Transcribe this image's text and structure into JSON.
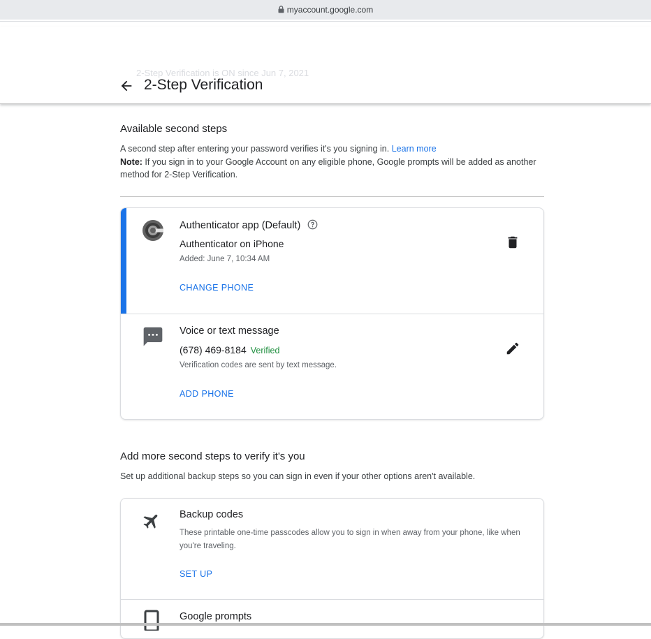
{
  "browser": {
    "url": "myaccount.google.com"
  },
  "header": {
    "title": "2-Step Verification",
    "ghost_text": "2-Step Verification is ON since Jun 7, 2021"
  },
  "available": {
    "heading": "Available second steps",
    "desc": "A second step after entering your password verifies it's you signing in.",
    "learn_more": "Learn more",
    "note_label": "Note:",
    "note_text": " If you sign in to your Google Account on any eligible phone, Google prompts will be added as another method for 2-Step Verification."
  },
  "methods": [
    {
      "title": "Authenticator app (Default)",
      "subtitle": "Authenticator on iPhone",
      "detail": "Added: June 7, 10:34 AM",
      "action_label": "CHANGE PHONE",
      "icon": "authenticator-icon",
      "accent": "#1a73e8"
    },
    {
      "title": "Voice or text message",
      "subtitle": "(678) 469-8184",
      "status": "Verified",
      "detail": "Verification codes are sent by text message.",
      "action_label": "ADD PHONE",
      "icon": "sms-icon"
    }
  ],
  "more": {
    "heading": "Add more second steps to verify it's you",
    "desc": "Set up additional backup steps so you can sign in even if your other options aren't available."
  },
  "backup": [
    {
      "title": "Backup codes",
      "desc": "These printable one-time passcodes allow you to sign in when away from your phone, like when you're traveling.",
      "action_label": "SET UP",
      "icon": "airplane-icon"
    },
    {
      "title": "Google prompts",
      "icon": "phone-icon"
    }
  ]
}
